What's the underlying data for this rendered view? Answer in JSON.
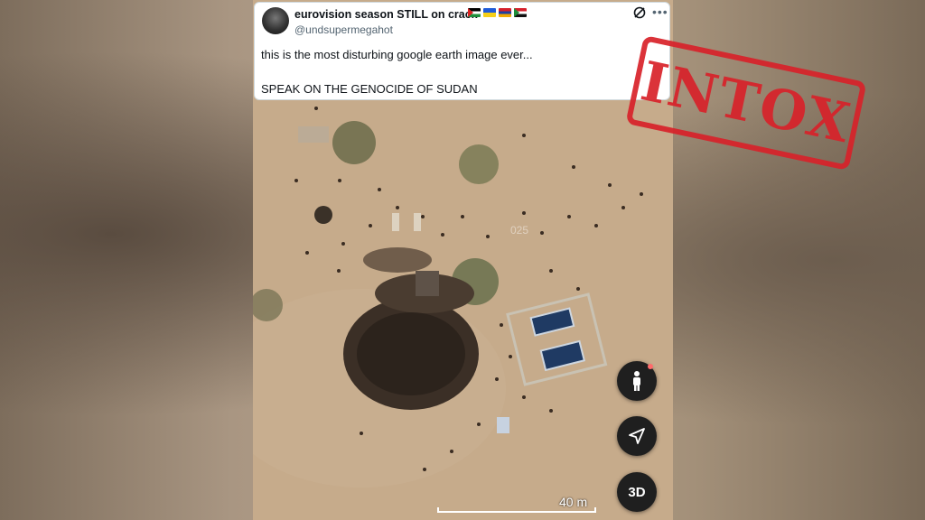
{
  "tweet": {
    "display_name": "eurovision season STILL on crack",
    "handle": "@undsupermegahot",
    "line1": "this is the most disturbing google earth image ever...",
    "line2": "SPEAK ON THE GENOCIDE OF SUDAN",
    "flags": [
      "palestine-flag",
      "ukraine-flag",
      "armenia-flag",
      "sudan-flag"
    ]
  },
  "stamp": {
    "text": "INTOX",
    "color": "#d8222a"
  },
  "map": {
    "controls": {
      "threed_label": "3D"
    },
    "scale_label": "40 m",
    "watermark": "025 "
  }
}
